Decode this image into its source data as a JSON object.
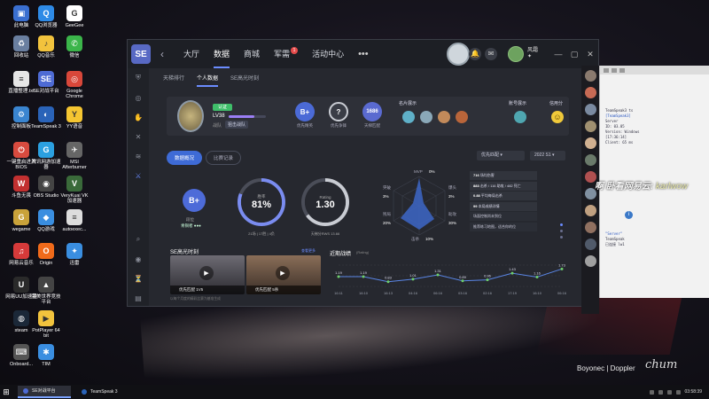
{
  "desktop": {
    "icons": [
      {
        "label": "此电脑",
        "x": 6,
        "y": 6,
        "color": "#3a6fd0",
        "glyph": "▣"
      },
      {
        "label": "QQ浏览器",
        "x": 34,
        "y": 6,
        "color": "#2e8ae6",
        "glyph": "Q"
      },
      {
        "label": "GeeGee",
        "x": 66,
        "y": 6,
        "color": "#ffffff",
        "glyph": "G"
      },
      {
        "label": "回收站",
        "x": 6,
        "y": 40,
        "color": "#6a7fa0",
        "glyph": "♻"
      },
      {
        "label": "QQ音乐",
        "x": 34,
        "y": 40,
        "color": "#f2c33d",
        "glyph": "♪"
      },
      {
        "label": "微信",
        "x": 66,
        "y": 40,
        "color": "#3bb54a",
        "glyph": "✆"
      },
      {
        "label": "直播整理.txt",
        "x": 6,
        "y": 80,
        "color": "#e6e6e6",
        "glyph": "≡"
      },
      {
        "label": "SE对战平台",
        "x": 34,
        "y": 80,
        "color": "#4e6bd4",
        "glyph": "SE"
      },
      {
        "label": "Google Chrome",
        "x": 66,
        "y": 80,
        "color": "#d8473a",
        "glyph": "◎"
      },
      {
        "label": "控制面板",
        "x": 6,
        "y": 120,
        "color": "#3a85d0",
        "glyph": "⚙"
      },
      {
        "label": "TeamSpeak 3",
        "x": 34,
        "y": 120,
        "color": "#2a63b8",
        "glyph": "◐"
      },
      {
        "label": "YY语音",
        "x": 66,
        "y": 120,
        "color": "#f5c531",
        "glyph": "Y"
      },
      {
        "label": "一键重启进入BIOS",
        "x": 6,
        "y": 160,
        "color": "#d84b3f",
        "glyph": "⏻"
      },
      {
        "label": "腾讯网游加速器",
        "x": 34,
        "y": 160,
        "color": "#2ba0e0",
        "glyph": "G"
      },
      {
        "label": "MSI Afterburner",
        "x": 66,
        "y": 160,
        "color": "#666666",
        "glyph": "✈"
      },
      {
        "label": "斗鱼无畏",
        "x": 6,
        "y": 198,
        "color": "#c23030",
        "glyph": "W"
      },
      {
        "label": "OBS Studio",
        "x": 34,
        "y": 198,
        "color": "#444444",
        "glyph": "◉"
      },
      {
        "label": "VeryKuai VK加速器",
        "x": 66,
        "y": 198,
        "color": "#3a6a3a",
        "glyph": "V"
      },
      {
        "label": "wegame",
        "x": 6,
        "y": 236,
        "color": "#c9a23a",
        "glyph": "G"
      },
      {
        "label": "QQ游戏",
        "x": 34,
        "y": 236,
        "color": "#3a8ee0",
        "glyph": "◆"
      },
      {
        "label": "autoexec...",
        "x": 66,
        "y": 236,
        "color": "#dddddd",
        "glyph": "≡"
      },
      {
        "label": "网易云音乐",
        "x": 6,
        "y": 274,
        "color": "#d63a3a",
        "glyph": "♫"
      },
      {
        "label": "Origin",
        "x": 34,
        "y": 274,
        "color": "#f06a1a",
        "glyph": "O"
      },
      {
        "label": "迅雷",
        "x": 66,
        "y": 274,
        "color": "#3a8ee0",
        "glyph": "✦"
      },
      {
        "label": "网易UU加速器",
        "x": 6,
        "y": 312,
        "color": "#2a2a2a",
        "glyph": "U"
      },
      {
        "label": "完美世界竞技平台",
        "x": 34,
        "y": 312,
        "color": "#444444",
        "glyph": "▲"
      },
      {
        "label": "steam",
        "x": 6,
        "y": 350,
        "color": "#1b2838",
        "glyph": "◍"
      },
      {
        "label": "PotPlayer 64 bit",
        "x": 34,
        "y": 350,
        "color": "#f2c33d",
        "glyph": "▶"
      },
      {
        "label": "Onboard...",
        "x": 6,
        "y": 388,
        "color": "#555555",
        "glyph": "⌨"
      },
      {
        "label": "TIM",
        "x": 34,
        "y": 388,
        "color": "#3a8ee0",
        "glyph": "✱"
      }
    ],
    "brand_line": "Boyonec | Doppler",
    "brand_sig": "chum"
  },
  "app": {
    "logo": "SE",
    "nav": [
      {
        "label": "大厅",
        "active": false
      },
      {
        "label": "数据",
        "active": true
      },
      {
        "label": "商城",
        "active": false
      },
      {
        "label": "军需",
        "active": false,
        "badge": "1"
      },
      {
        "label": "活动中心",
        "active": false
      }
    ],
    "more": "•••",
    "user_name": "风霜",
    "user_sub": "✦",
    "win_controls": [
      "—",
      "▢",
      "✕"
    ],
    "subnav": [
      {
        "label": "天梯排行",
        "active": false
      },
      {
        "label": "个人数据",
        "active": true
      },
      {
        "label": "SE高光时刻",
        "active": false
      }
    ],
    "profile": {
      "level_tag": "认证",
      "level": "LV38",
      "level_progress": 0.7,
      "team_label": "战队",
      "team_name": "狙击战队",
      "badges": [
        {
          "label": "优先精英",
          "text": "B+",
          "color": "#4b6ad6"
        },
        {
          "label": "优先争锋",
          "text": "?",
          "color": "#3a3d46"
        },
        {
          "label": "天梯匹配",
          "text": "1686",
          "color": "#5a6ad0"
        }
      ],
      "showcase_label": "名片展示",
      "account_label": "账号展示",
      "credit_label": "信用分"
    },
    "mode_tabs": [
      {
        "label": "数据概况",
        "active": true
      },
      {
        "label": "比赛记录",
        "active": false
      }
    ],
    "mode_select": "优先匹配",
    "season_select": "2022 S1",
    "rank": {
      "text": "B+",
      "label": "段位",
      "sub": "青铜者 ●●●"
    },
    "winrate": {
      "label": "胜率",
      "value": "81%",
      "sub": "21场 | 17胜 | 4负",
      "pct": 81
    },
    "rating": {
      "label": "Rating",
      "value": "1.30",
      "sub": "天梯分RWS 13.66",
      "pct": 65
    },
    "radar": {
      "labels": {
        "top": "MVP",
        "tr": "爆头",
        "br": "助攻",
        "bottom": "击杀",
        "bl": "残局",
        "tl": "突破"
      },
      "values": {
        "top": "0%",
        "tr": "3%",
        "br": "30%",
        "bottom": "10%",
        "bl": "20%",
        "tl": "3%"
      }
    },
    "stats_list": [
      {
        "value": "716",
        "label": "场均伤害"
      },
      {
        "value": "883",
        "label": "击杀 / 116 助攻 / 482 死亡"
      },
      {
        "value": "0.88",
        "label": "平均每局击杀"
      },
      {
        "value": "99",
        "label": "本局成绩详情"
      },
      {
        "value": "",
        "label": "场面控制尚未到位"
      },
      {
        "value": "",
        "label": "推荐练习地图，适合你的位"
      }
    ],
    "clips": {
      "title": "SE高光时刻",
      "more": "查看更多",
      "items": [
        {
          "caption": "优先匹配 1V5"
        },
        {
          "caption": "优先匹配 5杀"
        }
      ],
      "footer": "以每个月度的精彩比赛为基准生成"
    },
    "perf": {
      "title": "近期战绩",
      "subtitle": "(Rating)"
    }
  },
  "chart_data": {
    "type": "line",
    "title": "近期战绩",
    "ylabel": "(Rating)",
    "categories": [
      "16:11",
      "16:10",
      "16:13",
      "04:16",
      "06:16",
      "03:16",
      "02:16",
      "17:19",
      "16:10",
      "06:16"
    ],
    "values": [
      1.19,
      1.19,
      0.83,
      1.01,
      1.31,
      0.89,
      0.96,
      1.43,
      1.16,
      1.73
    ],
    "ylim": [
      0.5,
      2.0
    ]
  },
  "teamspeak": {
    "lines": [
      {
        "text": "TeamSpeak3 ts",
        "cls": ""
      },
      {
        "text": "[TeamSpeak3]",
        "cls": "blue"
      },
      {
        "text": "Server",
        "cls": ""
      },
      {
        "text": "ID: 03.05",
        "cls": ""
      },
      {
        "text": "Version: Windows",
        "cls": ""
      },
      {
        "text": "[17:36:14]",
        "cls": ""
      },
      {
        "text": "Client: 65 ms",
        "cls": ""
      }
    ],
    "lower_lines": [
      {
        "text": "\"Server\"",
        "cls": "blue"
      },
      {
        "text": "TeamSpeak",
        "cls": ""
      },
      {
        "text": "已连接 lw1",
        "cls": ""
      }
    ],
    "overlay": "啊 卧看网易云:",
    "overlay_name": "karlwow"
  },
  "taskbar": {
    "start": "⊞",
    "apps": [
      {
        "label": "SE对战平台",
        "active": true,
        "color": "#4e6bd4"
      },
      {
        "label": "TeamSpeak 3",
        "active": false,
        "color": "#2a63b8"
      }
    ],
    "clock": "03:58:39"
  }
}
